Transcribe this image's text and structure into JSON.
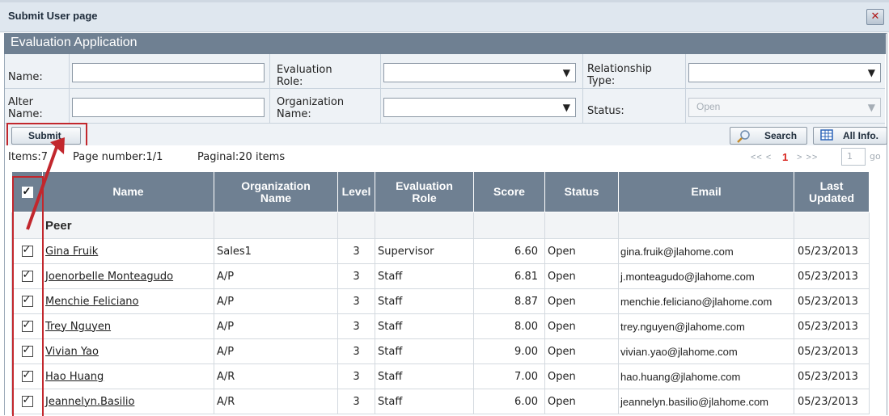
{
  "window": {
    "title": "Submit User page"
  },
  "app": {
    "title": "Evaluation Application"
  },
  "form": {
    "name_label": "Name:",
    "eval_role_label": "Evaluation\nRole:",
    "relationship_label": "Relationship\nType:",
    "alter_name_label": "Alter\nName:",
    "org_name_label": "Organization\nName:",
    "status_label": "Status:",
    "status_value": "Open",
    "name_value": "",
    "alter_name_value": ""
  },
  "toolbar": {
    "submit_label": "Submit",
    "search_label": "Search",
    "allinfo_label": "All Info."
  },
  "info": {
    "items_text": "Items:7",
    "page_text": "Page number:1/1",
    "paginal_text": "Paginal:20 items",
    "pager_prev": "<< <",
    "pager_current": "1",
    "pager_next": "> >>",
    "page_input": "1",
    "go_label": "go"
  },
  "table": {
    "headers": {
      "name": "Name",
      "org": "Organization\nName",
      "level": "Level",
      "role": "Evaluation\nRole",
      "score": "Score",
      "status": "Status",
      "email": "Email",
      "updated": "Last\nUpdated"
    },
    "group_label": "Peer",
    "rows": [
      {
        "name": "Gina Fruik",
        "org": "Sales1",
        "level": "3",
        "role": "Supervisor",
        "score": "6.60",
        "status": "Open",
        "email": "gina.fruik@jlahome.com",
        "updated": "05/23/2013"
      },
      {
        "name": "Joenorbelle Monteagudo",
        "org": "A/P",
        "level": "3",
        "role": "Staff",
        "score": "6.81",
        "status": "Open",
        "email": "j.monteagudo@jlahome.com",
        "updated": "05/23/2013"
      },
      {
        "name": "Menchie Feliciano",
        "org": "A/P",
        "level": "3",
        "role": "Staff",
        "score": "8.87",
        "status": "Open",
        "email": "menchie.feliciano@jlahome.com",
        "updated": "05/23/2013"
      },
      {
        "name": "Trey Nguyen",
        "org": "A/P",
        "level": "3",
        "role": "Staff",
        "score": "8.00",
        "status": "Open",
        "email": "trey.nguyen@jlahome.com",
        "updated": "05/23/2013"
      },
      {
        "name": "Vivian Yao",
        "org": "A/P",
        "level": "3",
        "role": "Staff",
        "score": "9.00",
        "status": "Open",
        "email": "vivian.yao@jlahome.com",
        "updated": "05/23/2013"
      },
      {
        "name": "Hao Huang",
        "org": "A/R",
        "level": "3",
        "role": "Staff",
        "score": "7.00",
        "status": "Open",
        "email": "hao.huang@jlahome.com",
        "updated": "05/23/2013"
      },
      {
        "name": "Jeannelyn.Basilio",
        "org": "A/R",
        "level": "3",
        "role": "Staff",
        "score": "6.00",
        "status": "Open",
        "email": "jeannelyn.basilio@jlahome.com",
        "updated": "05/23/2013"
      }
    ]
  },
  "colors": {
    "header_bg": "#6f8092",
    "highlight": "#c2272d",
    "pager_current": "#d8231d"
  }
}
